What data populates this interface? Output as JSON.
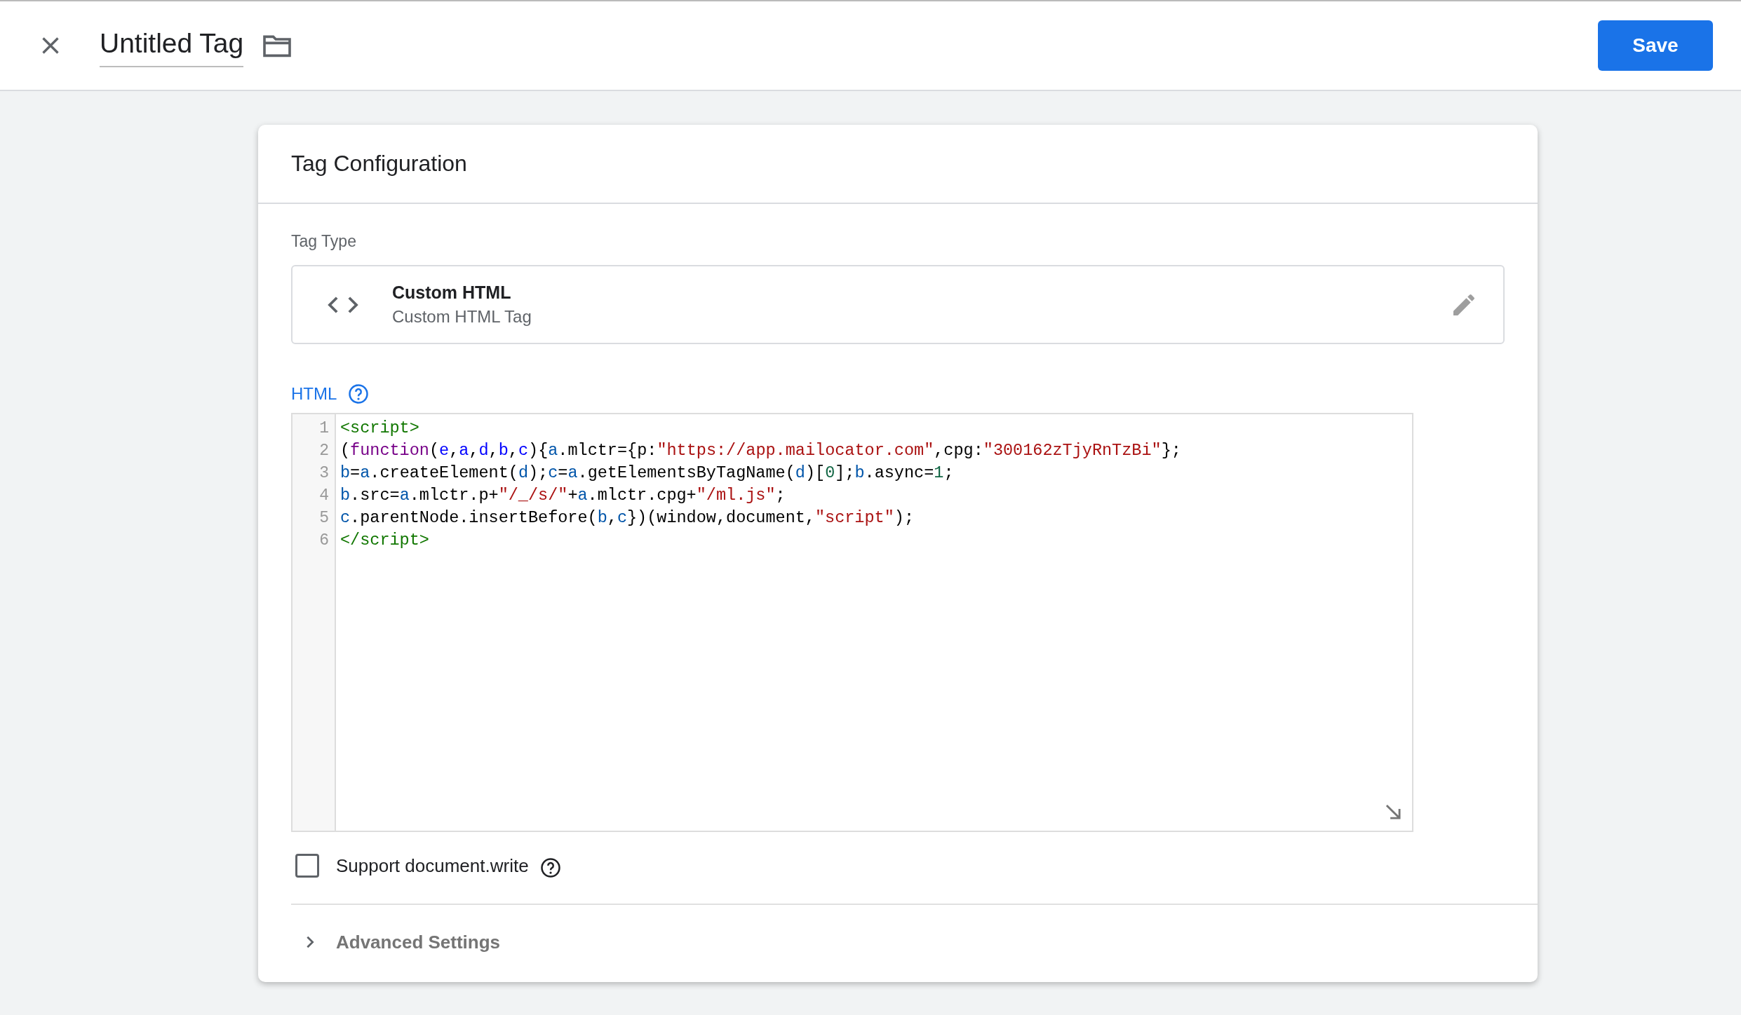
{
  "header": {
    "title": "Untitled Tag",
    "save_button": "Save"
  },
  "card": {
    "title": "Tag Configuration",
    "tag_type": {
      "label": "Tag Type",
      "name": "Custom HTML",
      "description": "Custom HTML Tag"
    },
    "html": {
      "label": "HTML",
      "lines": [
        {
          "number": "1",
          "tokens": [
            {
              "kind": "tag",
              "text": "<script>"
            }
          ]
        },
        {
          "number": "2",
          "tokens": [
            {
              "kind": "plain",
              "text": "("
            },
            {
              "kind": "keyword",
              "text": "function"
            },
            {
              "kind": "plain",
              "text": "("
            },
            {
              "kind": "def",
              "text": "e"
            },
            {
              "kind": "plain",
              "text": ","
            },
            {
              "kind": "def",
              "text": "a"
            },
            {
              "kind": "plain",
              "text": ","
            },
            {
              "kind": "def",
              "text": "d"
            },
            {
              "kind": "plain",
              "text": ","
            },
            {
              "kind": "def",
              "text": "b"
            },
            {
              "kind": "plain",
              "text": ","
            },
            {
              "kind": "def",
              "text": "c"
            },
            {
              "kind": "plain",
              "text": "){"
            },
            {
              "kind": "var",
              "text": "a"
            },
            {
              "kind": "plain",
              "text": ".mlctr={p:"
            },
            {
              "kind": "string",
              "text": "\"https://app.mailocator.com\""
            },
            {
              "kind": "plain",
              "text": ",cpg:"
            },
            {
              "kind": "string",
              "text": "\"300162zTjyRnTzBi\""
            },
            {
              "kind": "plain",
              "text": "};"
            }
          ]
        },
        {
          "number": "3",
          "tokens": [
            {
              "kind": "var",
              "text": "b"
            },
            {
              "kind": "plain",
              "text": "="
            },
            {
              "kind": "var",
              "text": "a"
            },
            {
              "kind": "plain",
              "text": ".createElement("
            },
            {
              "kind": "var",
              "text": "d"
            },
            {
              "kind": "plain",
              "text": ");"
            },
            {
              "kind": "var",
              "text": "c"
            },
            {
              "kind": "plain",
              "text": "="
            },
            {
              "kind": "var",
              "text": "a"
            },
            {
              "kind": "plain",
              "text": ".getElementsByTagName("
            },
            {
              "kind": "var",
              "text": "d"
            },
            {
              "kind": "plain",
              "text": ")["
            },
            {
              "kind": "number",
              "text": "0"
            },
            {
              "kind": "plain",
              "text": "];"
            },
            {
              "kind": "var",
              "text": "b"
            },
            {
              "kind": "plain",
              "text": ".async="
            },
            {
              "kind": "number",
              "text": "1"
            },
            {
              "kind": "plain",
              "text": ";"
            }
          ]
        },
        {
          "number": "4",
          "tokens": [
            {
              "kind": "var",
              "text": "b"
            },
            {
              "kind": "plain",
              "text": ".src="
            },
            {
              "kind": "var",
              "text": "a"
            },
            {
              "kind": "plain",
              "text": ".mlctr.p+"
            },
            {
              "kind": "string",
              "text": "\"/_/s/\""
            },
            {
              "kind": "plain",
              "text": "+"
            },
            {
              "kind": "var",
              "text": "a"
            },
            {
              "kind": "plain",
              "text": ".mlctr.cpg+"
            },
            {
              "kind": "string",
              "text": "\"/ml.js\""
            },
            {
              "kind": "plain",
              "text": ";"
            }
          ]
        },
        {
          "number": "5",
          "tokens": [
            {
              "kind": "var",
              "text": "c"
            },
            {
              "kind": "plain",
              "text": ".parentNode.insertBefore("
            },
            {
              "kind": "var",
              "text": "b"
            },
            {
              "kind": "plain",
              "text": ","
            },
            {
              "kind": "var",
              "text": "c"
            },
            {
              "kind": "plain",
              "text": "})(window,document,"
            },
            {
              "kind": "string",
              "text": "\"script\""
            },
            {
              "kind": "plain",
              "text": ");"
            }
          ]
        },
        {
          "number": "6",
          "tokens": [
            {
              "kind": "tag",
              "text": "</script>"
            }
          ]
        }
      ]
    },
    "support_document_write": {
      "label": "Support document.write",
      "checked": false
    },
    "advanced_settings": {
      "label": "Advanced Settings",
      "expanded": false
    }
  }
}
